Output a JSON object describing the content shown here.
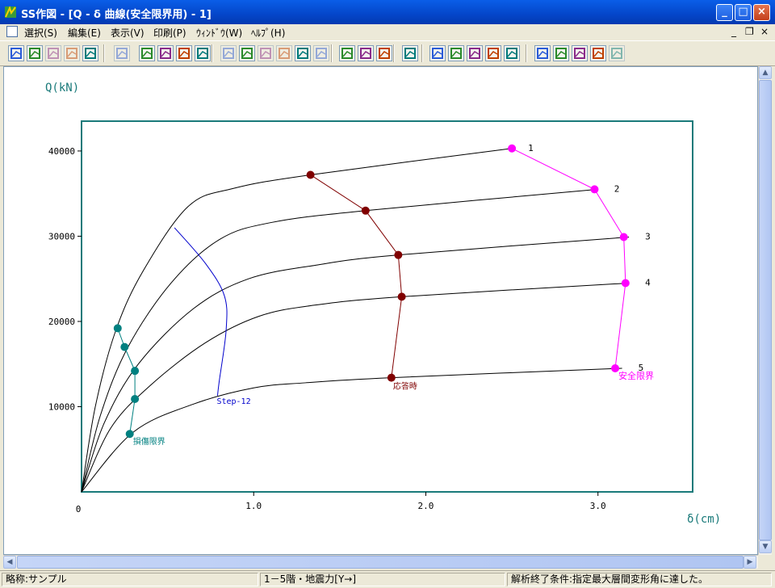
{
  "window": {
    "title": "SS作図 - [Q - δ 曲線(安全限界用) - 1]",
    "buttons": {
      "minimize": "_",
      "maximize": "□",
      "close": "×"
    }
  },
  "menu": {
    "items": [
      "選択(S)",
      "編集(E)",
      "表示(V)",
      "印刷(P)",
      "ｳｨﾝﾄﾞｳ(W)",
      "ﾍﾙﾌﾟ(H)"
    ],
    "mdi_controls": {
      "minimize": "_",
      "restore": "❐",
      "close": "×"
    }
  },
  "toolbar": {
    "icons": [
      "grid-icon",
      "frame-icon",
      "hex-icon",
      "panel-icon",
      "refresh-icon",
      "page-icon",
      "down-icon",
      "up-icon",
      "double-down-icon",
      "double-up-icon",
      "undo-icon",
      "hand-icon",
      "zoom-icon",
      "calc-icon",
      "s-icon",
      "print2-icon",
      "printer-icon",
      "preview-icon",
      "setup-icon",
      "help-icon",
      "graph1-icon",
      "graph2-icon",
      "graph3-icon",
      "graph4-icon",
      "graph5-icon",
      "graph6-icon",
      "graph7-icon",
      "graph8-icon",
      "graph9-icon",
      "graph10-icon"
    ],
    "accent": "#0a8a8a"
  },
  "chart_data": {
    "type": "line",
    "ylabel": "Q(kN)",
    "xlabel": "δ(cm)",
    "xlim": [
      0,
      3.55
    ],
    "ylim": [
      0,
      43500
    ],
    "x_ticks": [
      {
        "v": 1,
        "label": "1.0"
      },
      {
        "v": 2,
        "label": "2.0"
      },
      {
        "v": 3,
        "label": "3.0"
      }
    ],
    "y_ticks": [
      {
        "v": 10000,
        "label": "10000"
      },
      {
        "v": 20000,
        "label": "20000"
      },
      {
        "v": 30000,
        "label": "30000"
      },
      {
        "v": 40000,
        "label": "40000"
      }
    ],
    "origin_label": "0",
    "colors": {
      "frame": "#1a7a7a",
      "curve": "#000000",
      "safety": "#ff00ff",
      "response": "#800000",
      "damage": "#008080",
      "step": "#0000cc"
    },
    "curves": [
      {
        "label": "1",
        "points": [
          [
            0,
            0
          ],
          [
            0.08,
            10000
          ],
          [
            0.2,
            19000
          ],
          [
            0.36,
            26000
          ],
          [
            0.62,
            33500
          ],
          [
            0.88,
            35600
          ],
          [
            1.33,
            37200
          ],
          [
            2.5,
            40300
          ]
        ]
      },
      {
        "label": "2",
        "points": [
          [
            0,
            0
          ],
          [
            0.11,
            9000
          ],
          [
            0.27,
            17000
          ],
          [
            0.52,
            24500
          ],
          [
            0.8,
            29600
          ],
          [
            1.1,
            31600
          ],
          [
            1.65,
            33000
          ],
          [
            3.0,
            35500
          ]
        ]
      },
      {
        "label": "3",
        "points": [
          [
            0,
            0
          ],
          [
            0.13,
            8000
          ],
          [
            0.33,
            15000
          ],
          [
            0.65,
            21500
          ],
          [
            0.97,
            25000
          ],
          [
            1.36,
            26600
          ],
          [
            1.84,
            27800
          ],
          [
            3.18,
            29900
          ]
        ]
      },
      {
        "label": "4",
        "points": [
          [
            0,
            0
          ],
          [
            0.17,
            7500
          ],
          [
            0.4,
            12500
          ],
          [
            0.72,
            17500
          ],
          [
            1.03,
            20600
          ],
          [
            1.35,
            21900
          ],
          [
            1.86,
            22900
          ],
          [
            3.18,
            24500
          ]
        ]
      },
      {
        "label": "5",
        "points": [
          [
            0,
            0
          ],
          [
            0.3,
            7000
          ],
          [
            0.65,
            10300
          ],
          [
            1.0,
            12200
          ],
          [
            1.3,
            12800
          ],
          [
            1.8,
            13400
          ],
          [
            3.14,
            14500
          ]
        ]
      }
    ],
    "safety_limit": {
      "label": "安全限界",
      "points": [
        [
          2.5,
          40300
        ],
        [
          2.98,
          35500
        ],
        [
          3.15,
          29900
        ],
        [
          3.16,
          24500
        ],
        [
          3.1,
          14500
        ]
      ]
    },
    "response": {
      "label": "応答時",
      "points": [
        [
          1.33,
          37200
        ],
        [
          1.65,
          33000
        ],
        [
          1.84,
          27800
        ],
        [
          1.86,
          22900
        ],
        [
          1.8,
          13400
        ]
      ]
    },
    "damage_limit": {
      "label": "損傷限界",
      "points": [
        [
          0.21,
          19200
        ],
        [
          0.25,
          17000
        ],
        [
          0.31,
          14200
        ],
        [
          0.31,
          10900
        ],
        [
          0.28,
          6800
        ]
      ]
    },
    "step_line": {
      "label": "Step-12",
      "points": [
        [
          0.54,
          31000
        ],
        [
          0.72,
          26800
        ],
        [
          0.83,
          23000
        ],
        [
          0.84,
          19000
        ],
        [
          0.8,
          13000
        ],
        [
          0.79,
          11300
        ]
      ]
    }
  },
  "status": {
    "left": "略称:サンプル",
    "middle": "1－5階・地震力[Y→]",
    "right": "解析終了条件:指定最大層間変形角に達した。"
  }
}
